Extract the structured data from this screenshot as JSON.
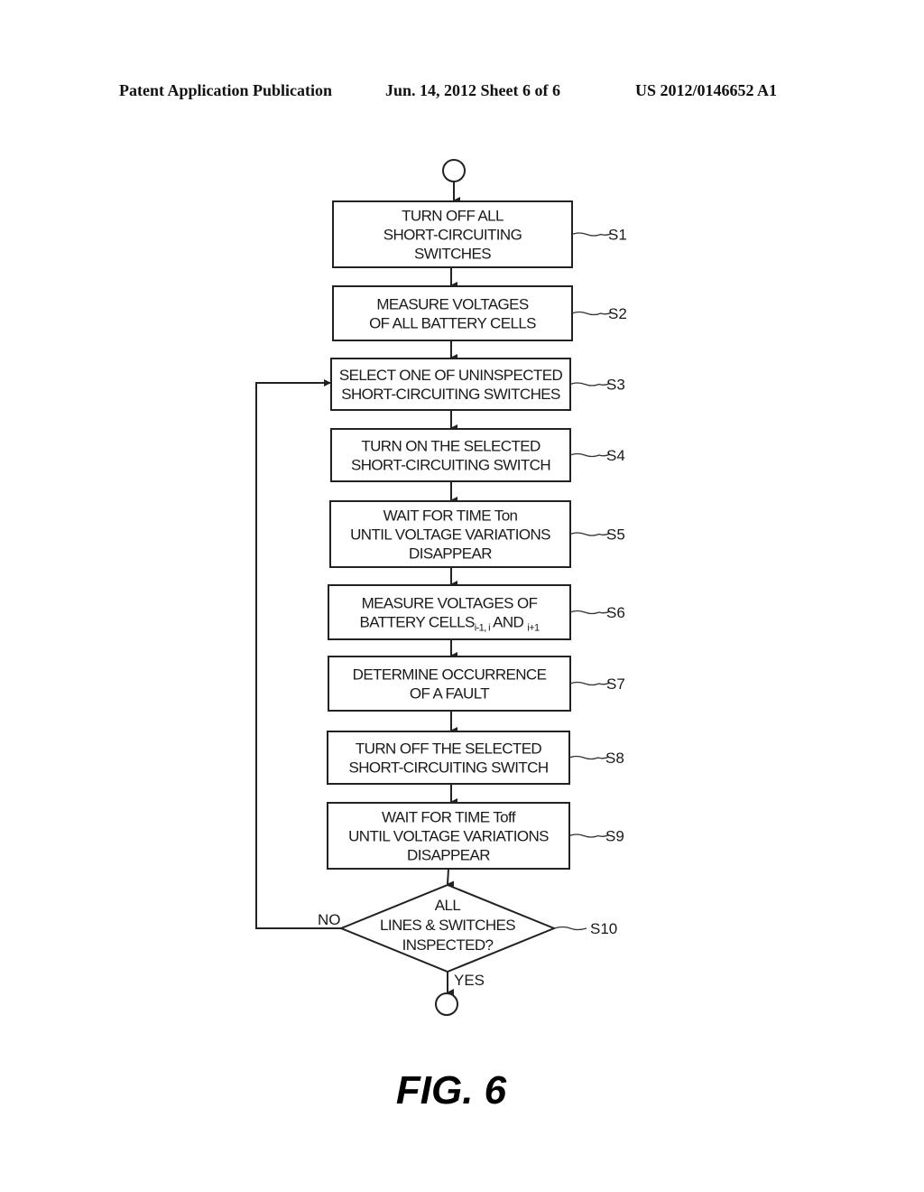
{
  "header": {
    "publication": "Patent Application Publication",
    "date_sheet": "Jun. 14, 2012   Sheet 6 of 6",
    "patent_number": "US 2012/0146652 A1"
  },
  "flowchart": {
    "steps": [
      {
        "id": "S1",
        "lines": [
          "TURN OFF ALL",
          "SHORT-CIRCUITING",
          "SWITCHES"
        ]
      },
      {
        "id": "S2",
        "lines": [
          "MEASURE VOLTAGES",
          "OF ALL BATTERY CELLS"
        ]
      },
      {
        "id": "S3",
        "lines": [
          "SELECT ONE OF UNINSPECTED",
          "SHORT-CIRCUITING SWITCHES"
        ]
      },
      {
        "id": "S4",
        "lines": [
          "TURN ON THE SELECTED",
          "SHORT-CIRCUITING SWITCH"
        ]
      },
      {
        "id": "S5",
        "lines": [
          "WAIT FOR TIME Ton",
          "UNTIL VOLTAGE VARIATIONS",
          "DISAPPEAR"
        ]
      },
      {
        "id": "S6",
        "lines": [
          "MEASURE VOLTAGES OF",
          "BATTERY CELLS"
        ],
        "subscript_a": "i-1, i",
        "mid": " AND ",
        "subscript_b": "i+1"
      },
      {
        "id": "S7",
        "lines": [
          "DETERMINE OCCURRENCE",
          "OF A FAULT"
        ]
      },
      {
        "id": "S8",
        "lines": [
          "TURN OFF THE SELECTED",
          "SHORT-CIRCUITING SWITCH"
        ]
      },
      {
        "id": "S9",
        "lines": [
          "WAIT FOR TIME Toff",
          "UNTIL VOLTAGE VARIATIONS",
          "DISAPPEAR"
        ]
      }
    ],
    "decision": {
      "id": "S10",
      "lines": [
        "ALL",
        "LINES & SWITCHES",
        "INSPECTED?"
      ],
      "no_label": "NO",
      "yes_label": "YES"
    }
  },
  "figure_label": "FIG. 6"
}
